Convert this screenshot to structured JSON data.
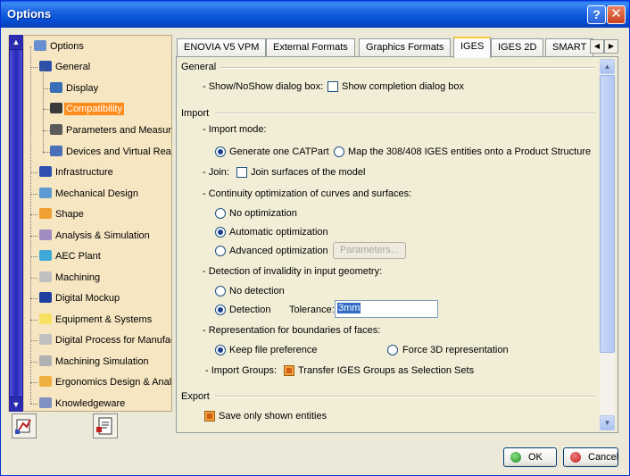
{
  "window": {
    "title": "Options",
    "help_glyph": "?",
    "close_glyph": "✕"
  },
  "tree": {
    "items": [
      {
        "label": "Options",
        "icon": "options-tree-icon",
        "icon_color": "#6a8fd0"
      },
      {
        "label": "General",
        "icon": "general-icon",
        "icon_color": "#2e4fa8"
      },
      {
        "label": "Display",
        "icon": "display-icon",
        "icon_color": "#3a6fb8"
      },
      {
        "label": "Compatibility",
        "icon": "compatibility-icon",
        "icon_color": "#3a3a3a"
      },
      {
        "label": "Parameters and Measure",
        "icon": "parameters-icon",
        "icon_color": "#5a5a5a"
      },
      {
        "label": "Devices and Virtual Realit",
        "icon": "devices-icon",
        "icon_color": "#4a6fb8"
      },
      {
        "label": "Infrastructure",
        "icon": "infrastructure-icon",
        "icon_color": "#3050b0"
      },
      {
        "label": "Mechanical Design",
        "icon": "mechanical-design-icon",
        "icon_color": "#5a9ad0"
      },
      {
        "label": "Shape",
        "icon": "shape-icon",
        "icon_color": "#f0a030"
      },
      {
        "label": "Analysis & Simulation",
        "icon": "analysis-icon",
        "icon_color": "#a08cc0"
      },
      {
        "label": "AEC Plant",
        "icon": "aec-plant-icon",
        "icon_color": "#40a8d8"
      },
      {
        "label": "Machining",
        "icon": "machining-icon",
        "icon_color": "#c0c0c0"
      },
      {
        "label": "Digital Mockup",
        "icon": "digital-mockup-icon",
        "icon_color": "#2040a0"
      },
      {
        "label": "Equipment & Systems",
        "icon": "equipment-icon",
        "icon_color": "#f8e060"
      },
      {
        "label": "Digital Process for Manufact",
        "icon": "digital-process-icon",
        "icon_color": "#c0c0c0"
      },
      {
        "label": "Machining Simulation",
        "icon": "machining-simulation-icon",
        "icon_color": "#b0b0b0"
      },
      {
        "label": "Ergonomics Design & Analys",
        "icon": "ergonomics-icon",
        "icon_color": "#f0b040"
      },
      {
        "label": "Knowledgeware",
        "icon": "knowledgeware-icon",
        "icon_color": "#8090c0"
      }
    ],
    "selected": "Compatibility"
  },
  "tabs": [
    {
      "label": "ENOVIA V5 VPM"
    },
    {
      "label": "External Formats"
    },
    {
      "label": "Graphics Formats"
    },
    {
      "label": "IGES"
    },
    {
      "label": "IGES 2D"
    },
    {
      "label": "SMART"
    }
  ],
  "active_tab": "IGES",
  "general": {
    "title": "General",
    "show_dialog_label": "- Show/NoShow dialog box:",
    "show_completion_label": "Show completion dialog box",
    "show_completion_checked": false
  },
  "import": {
    "title": "Import",
    "mode_label": "- Import mode:",
    "mode_opt1": "Generate one CATPart",
    "mode_opt2": "Map the 308/408 IGES entities onto a Product Structure",
    "join_label": "- Join:",
    "join_checkbox": "Join surfaces of the model",
    "continuity_label": "- Continuity optimization of curves and surfaces:",
    "cont_opt1": "No optimization",
    "cont_opt2": "Automatic optimization",
    "cont_opt3": "Advanced optimization",
    "parameters_button": "Parameters...",
    "invalidity_label": "- Detection of invalidity in input geometry:",
    "inv_opt1": "No detection",
    "inv_opt2": "Detection",
    "tolerance_label": "Tolerance:",
    "tolerance_value": "3mm",
    "boundaries_label": "- Representation for boundaries of faces:",
    "bnd_opt1": "Keep file preference",
    "bnd_opt2": "Force 3D representation",
    "groups_label": "- Import Groups:",
    "groups_checkbox": "Transfer IGES Groups as Selection Sets"
  },
  "export": {
    "title": "Export",
    "save_shown_label": "Save only shown entities"
  },
  "footer": {
    "ok": "OK",
    "cancel": "Cancel"
  }
}
